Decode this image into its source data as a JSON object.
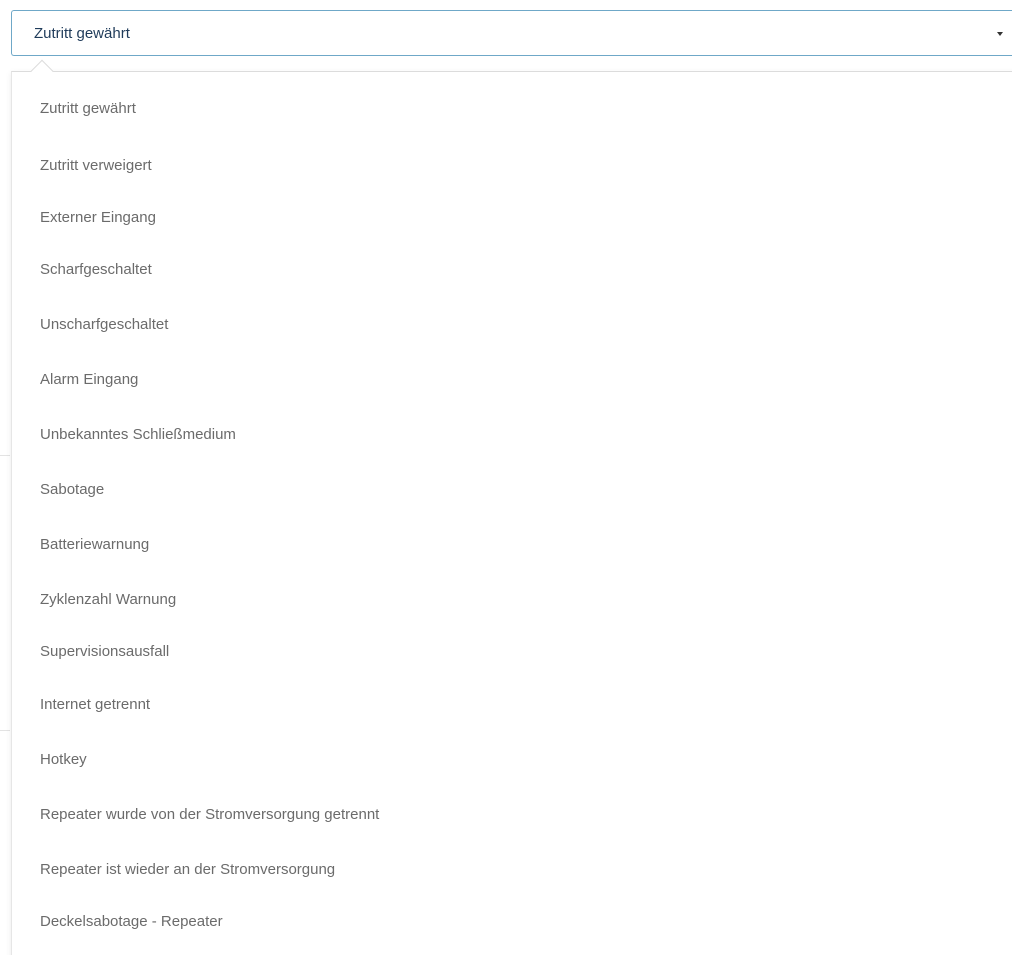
{
  "select": {
    "value": "Zutritt gewährt",
    "caret_icon": "caret-down-icon"
  },
  "dropdown": {
    "options": [
      {
        "label": "Zutritt gewährt"
      },
      {
        "label": "Zutritt verweigert"
      },
      {
        "label": "Externer Eingang"
      },
      {
        "label": "Scharfgeschaltet"
      },
      {
        "label": "Unscharfgeschaltet"
      },
      {
        "label": "Alarm Eingang"
      },
      {
        "label": "Unbekanntes Schließmedium"
      },
      {
        "label": "Sabotage"
      },
      {
        "label": "Batteriewarnung"
      },
      {
        "label": "Zyklenzahl Warnung"
      },
      {
        "label": "Supervisionsausfall"
      },
      {
        "label": "Internet getrennt"
      },
      {
        "label": "Hotkey"
      },
      {
        "label": "Repeater wurde von der Stromversorgung getrennt"
      },
      {
        "label": "Repeater ist wieder an der Stromversorgung"
      },
      {
        "label": "Deckelsabotage - Repeater"
      }
    ]
  },
  "colors": {
    "select_border": "#6fa8c8",
    "select_text": "#1f3b5a",
    "option_text": "#6b6b6b"
  }
}
